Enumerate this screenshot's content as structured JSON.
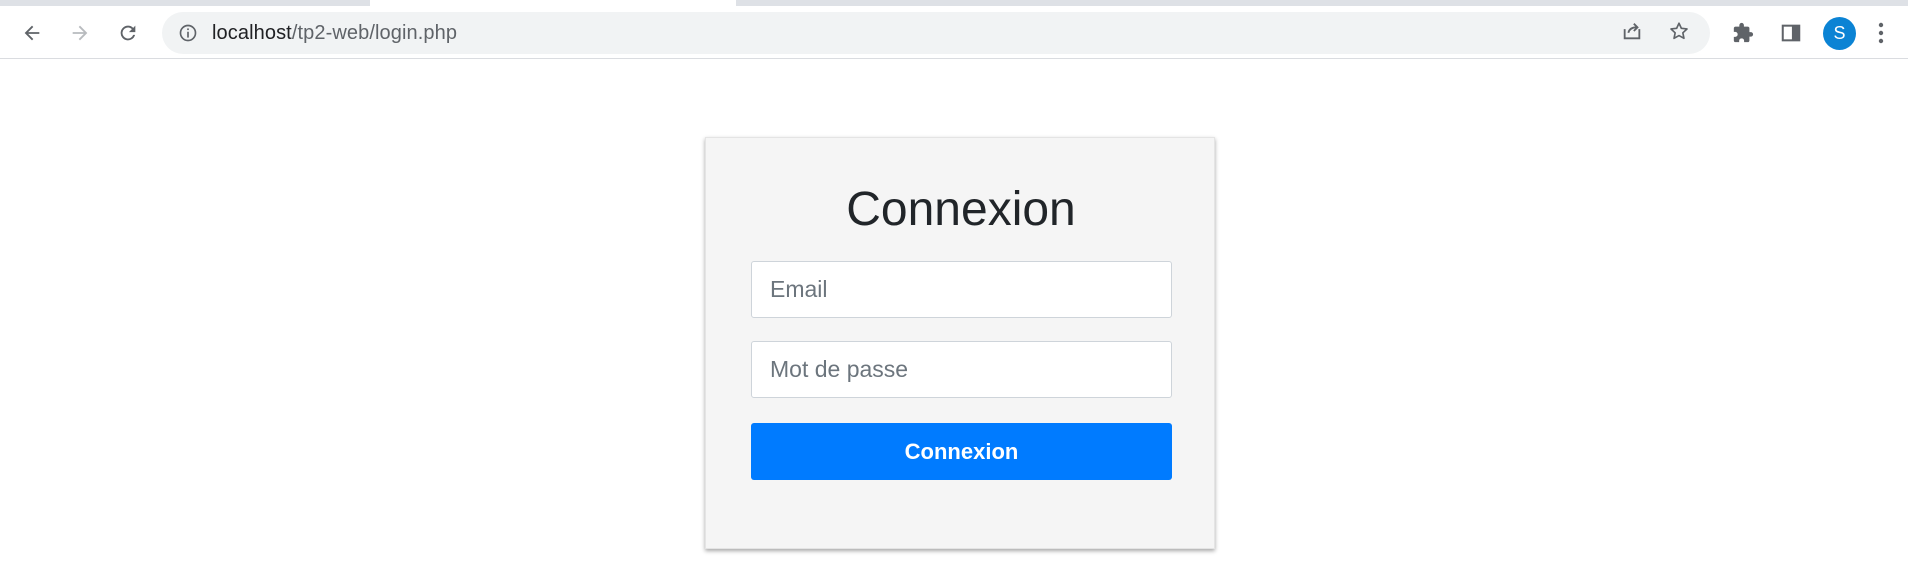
{
  "browser": {
    "url_host": "localhost",
    "url_path": "/tp2-web/login.php",
    "profile_initial": "S",
    "icons": {
      "back": "back-arrow-icon",
      "forward": "forward-arrow-icon",
      "reload": "reload-icon",
      "site_info": "info-icon",
      "share": "share-icon",
      "bookmark": "star-icon",
      "extensions": "puzzle-icon",
      "side_panel": "side-panel-icon",
      "menu": "kebab-menu-icon"
    },
    "colors": {
      "avatar": "#0b83d4"
    }
  },
  "login": {
    "title": "Connexion",
    "email_placeholder": "Email",
    "password_placeholder": "Mot de passe",
    "submit_label": "Connexion"
  },
  "colors": {
    "primary_button": "#007bff",
    "card_background": "#f5f5f5",
    "title_text": "#212529"
  }
}
